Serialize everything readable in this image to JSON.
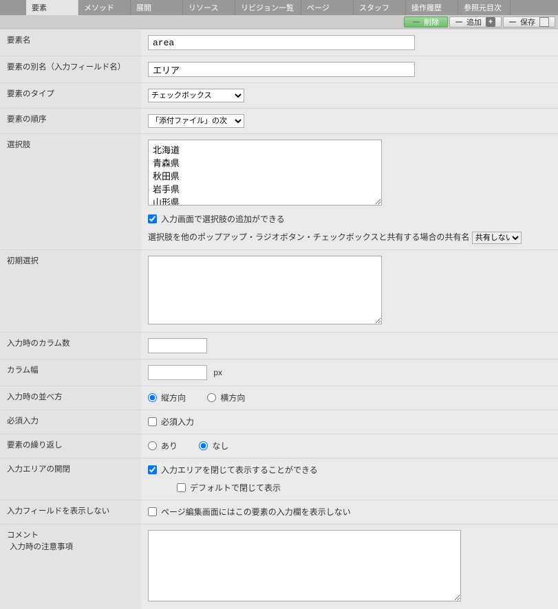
{
  "tabs": [
    "要素",
    "メソッド",
    "展開",
    "リソース",
    "リビジョン一覧",
    "ページ",
    "スタッフ",
    "操作履歴",
    "参照元目次"
  ],
  "activeTab": 0,
  "actions": {
    "delete": "削除",
    "add": "追加",
    "save": "保存"
  },
  "labels": {
    "name": "要素名",
    "alias": "要素の別名（入力フィールド名）",
    "type": "要素のタイプ",
    "order": "要素の順序",
    "options": "選択肢",
    "optionsAddable": "入力画面で選択肢の追加ができる",
    "shareLabel": "選択肢を他のポップアップ・ラジオボタン・チェックボックスと共有する場合の共有名",
    "initial": "初期選択",
    "columns": "入力時のカラム数",
    "colwidth": "カラム幅",
    "orient": "入力時の並べ方",
    "orientV": "縦方向",
    "orientH": "横方向",
    "required": "必須入力",
    "requiredCheck": "必須入力",
    "repeat": "要素の繰り返し",
    "repeatYes": "あり",
    "repeatNo": "なし",
    "collapse": "入力エリアの開閉",
    "collapseCheck": "入力エリアを閉じて表示することができる",
    "collapseDefault": "デフォルトで閉じて表示",
    "hide": "入力フィールドを表示しない",
    "hideCheck": "ページ編集画面にはこの要素の入力欄を表示しない",
    "comment": "コメント",
    "commentSub": "入力時の注意事項",
    "px": "px"
  },
  "values": {
    "name": "area",
    "alias": "エリア",
    "type": "チェックボックス",
    "order": "「添付ファイル」の次",
    "options": "北海道\n青森県\n秋田県\n岩手県\n山形県",
    "optionsAddable": true,
    "share": "共有しない",
    "initial": "",
    "columns": "",
    "colwidth": "",
    "orient": "v",
    "required": false,
    "repeat": "no",
    "collapse": true,
    "collapseDefault": false,
    "hide": false,
    "comment": ""
  }
}
